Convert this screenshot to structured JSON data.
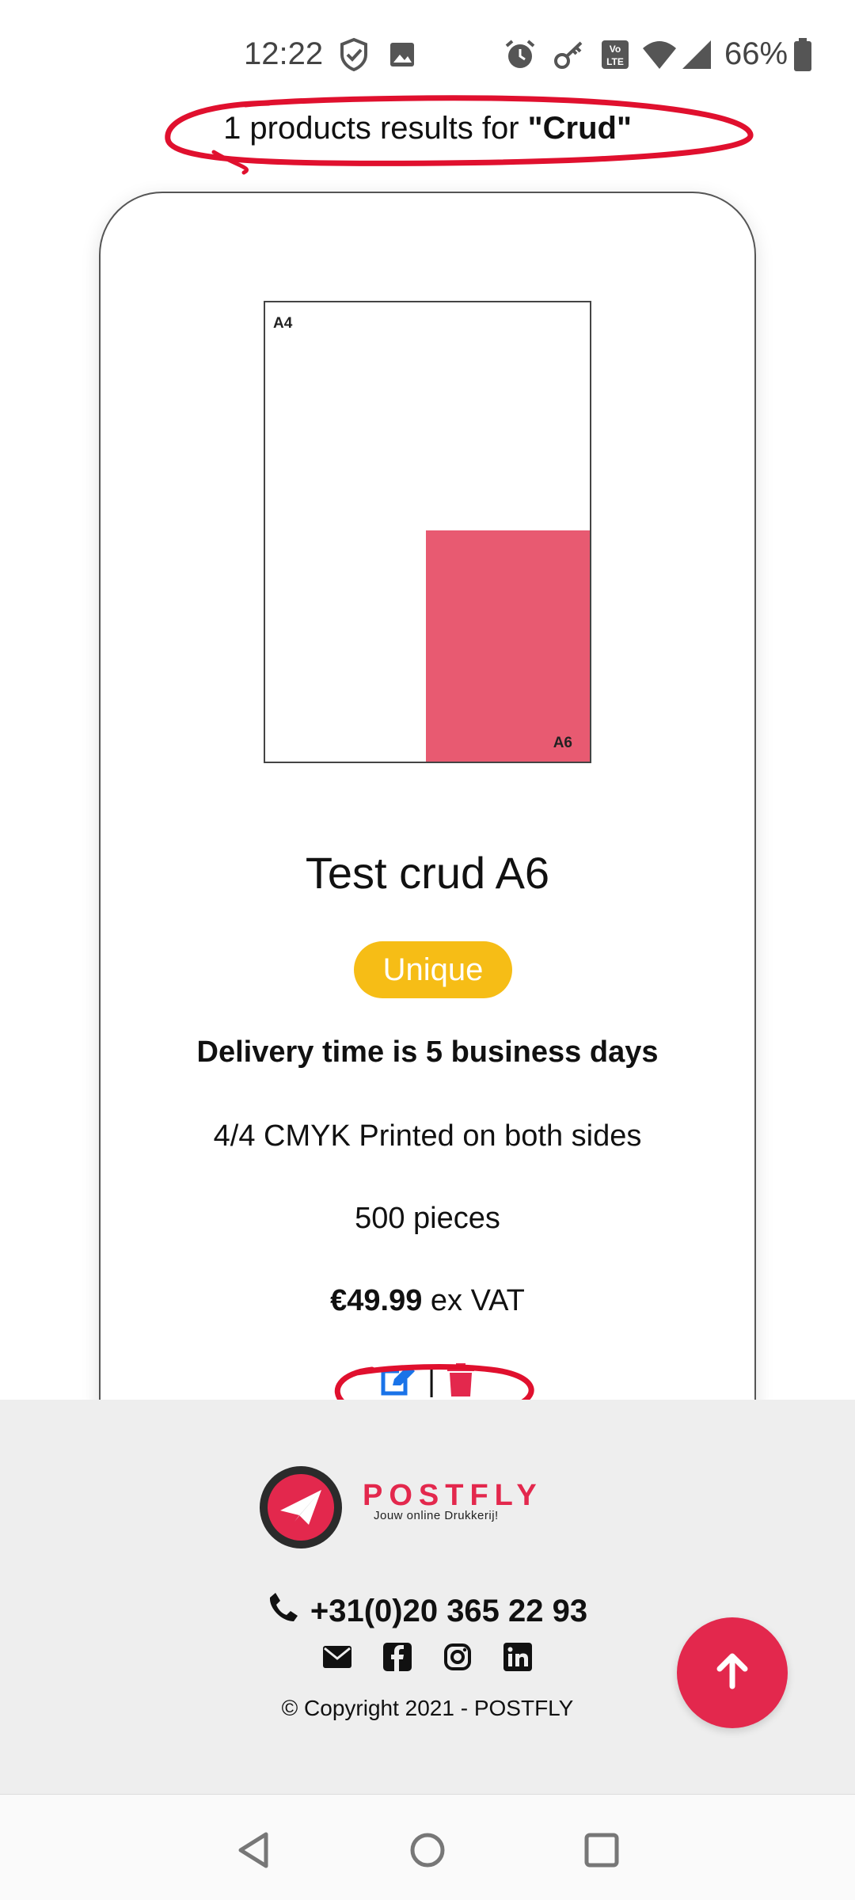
{
  "status_bar": {
    "time": "12:22",
    "battery": "66%"
  },
  "search": {
    "prefix": "1 products results for ",
    "query": "\"Crud\""
  },
  "product": {
    "preview_big_label": "A4",
    "preview_small_label": "A6",
    "title": "Test crud A6",
    "badge": "Unique",
    "delivery": "Delivery time is 5 business days",
    "print": "4/4 CMYK Printed on both sides",
    "quantity": "500 pieces",
    "price": "€49.99",
    "price_suffix": " ex VAT",
    "action_separator": "|"
  },
  "footer": {
    "brand": "POSTFLY",
    "tagline": "Jouw online Drukkerij!",
    "phone": "+31(0)20 365 22 93",
    "copyright": "© Copyright 2021 - POSTFLY"
  },
  "icons": {
    "status": [
      "shield-check-icon",
      "image-icon",
      "alarm-icon",
      "key-icon",
      "volte-icon",
      "wifi-icon",
      "signal-icon",
      "battery-icon"
    ],
    "actions": [
      "edit-icon",
      "trash-icon"
    ],
    "socials": [
      "envelope-icon",
      "facebook-icon",
      "instagram-icon",
      "linkedin-icon"
    ]
  },
  "colors": {
    "accent": "#e3284d",
    "badge": "#f6bd16",
    "edit_icon": "#1a73e8",
    "delete_icon": "#e3284d",
    "preview_fill": "#e85a71",
    "annotation": "#e0102e"
  }
}
